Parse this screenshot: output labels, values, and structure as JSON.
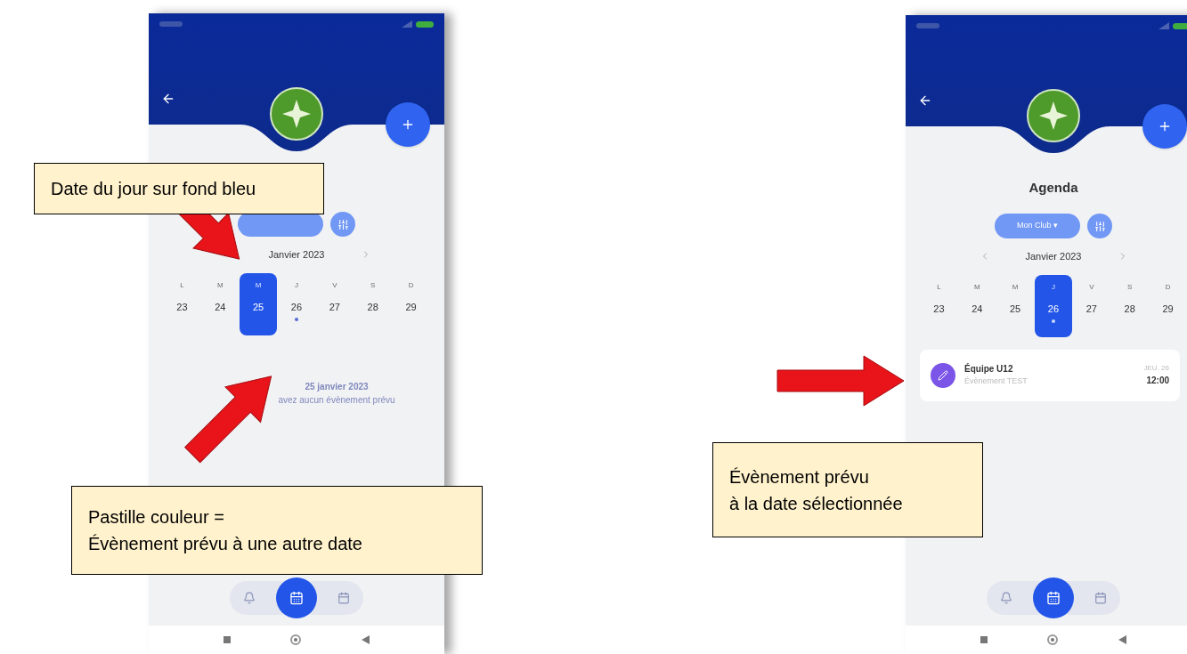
{
  "phones": [
    {
      "month": "Janvier 2023",
      "days": [
        {
          "weekday": "L",
          "date": "23",
          "selected": false,
          "has_event": false
        },
        {
          "weekday": "M",
          "date": "24",
          "selected": false,
          "has_event": false
        },
        {
          "weekday": "M",
          "date": "25",
          "selected": true,
          "has_event": false
        },
        {
          "weekday": "J",
          "date": "26",
          "selected": false,
          "has_event": true
        },
        {
          "weekday": "V",
          "date": "27",
          "selected": false,
          "has_event": false
        },
        {
          "weekday": "S",
          "date": "28",
          "selected": false,
          "has_event": false
        },
        {
          "weekday": "D",
          "date": "29",
          "selected": false,
          "has_event": false
        }
      ],
      "message": [
        "25 janvier 2023",
        "avez aucun évènement prévu"
      ],
      "nav_items": [
        {
          "kind": "bell",
          "selected": false
        },
        {
          "kind": "agenda",
          "selected": true
        },
        {
          "kind": "calendar",
          "selected": false
        }
      ]
    },
    {
      "title": "Agenda",
      "filter_chip": {
        "label": "Mon Club ▾"
      },
      "month": "Janvier 2023",
      "days": [
        {
          "weekday": "L",
          "date": "23",
          "selected": false,
          "has_event": false
        },
        {
          "weekday": "M",
          "date": "24",
          "selected": false,
          "has_event": false
        },
        {
          "weekday": "M",
          "date": "25",
          "selected": false,
          "has_event": false
        },
        {
          "weekday": "J",
          "date": "26",
          "selected": true,
          "has_event": true
        },
        {
          "weekday": "V",
          "date": "27",
          "selected": false,
          "has_event": false
        },
        {
          "weekday": "S",
          "date": "28",
          "selected": false,
          "has_event": false
        },
        {
          "weekday": "D",
          "date": "29",
          "selected": false,
          "has_event": false
        }
      ],
      "events": [
        {
          "title": "Équipe U12",
          "subtitle": "Évènement TEST",
          "day": "JEU. 26",
          "time": "12:00"
        }
      ],
      "nav_items": [
        {
          "kind": "bell",
          "selected": false
        },
        {
          "kind": "agenda",
          "selected": true
        },
        {
          "kind": "calendar",
          "selected": false
        }
      ]
    }
  ],
  "callouts": [
    {
      "lines": [
        "Date du jour sur fond bleu"
      ]
    },
    {
      "lines": [
        "Pastille couleur =",
        "Évènement prévu à une autre date"
      ]
    },
    {
      "lines": [
        "Évènement prévu",
        "à la date sélectionnée"
      ]
    }
  ]
}
